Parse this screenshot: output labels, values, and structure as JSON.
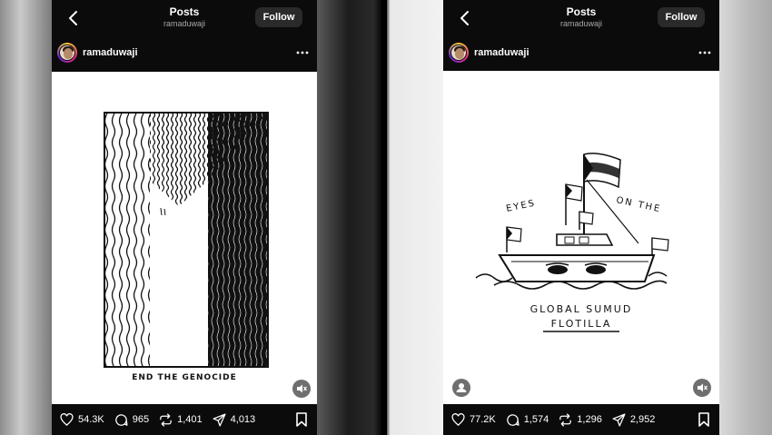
{
  "colors": {
    "phone_bg": "#0b0b0b",
    "follow_bg": "#2a2a2a",
    "text_primary": "#ffffff",
    "text_secondary": "#a8a8a8"
  },
  "left": {
    "header": {
      "title": "Posts",
      "subtitle": "ramaduwaji",
      "follow_label": "Follow"
    },
    "user": {
      "username": "ramaduwaji"
    },
    "post": {
      "caption": "END THE GENOCIDE"
    },
    "stats": {
      "likes": "54.3K",
      "comments": "965",
      "reposts": "1,401",
      "shares": "4,013"
    }
  },
  "right": {
    "header": {
      "title": "Posts",
      "subtitle": "ramaduwaji",
      "follow_label": "Follow"
    },
    "user": {
      "username": "ramaduwaji"
    },
    "post": {
      "text_eyes": "EYES",
      "text_on_the": "ON THE",
      "text_line1": "GLOBAL SUMUD",
      "text_line2": "FLOTILLA"
    },
    "stats": {
      "likes": "77.2K",
      "comments": "1,574",
      "reposts": "1,296",
      "shares": "2,952"
    }
  },
  "icons": [
    "back-icon",
    "more-icon",
    "heart-icon",
    "comment-icon",
    "repost-icon",
    "share-icon",
    "bookmark-icon",
    "mute-icon",
    "user-tag-icon"
  ]
}
